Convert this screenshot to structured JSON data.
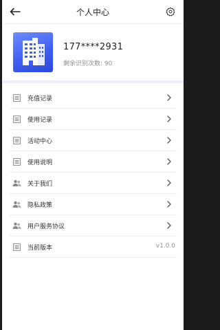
{
  "header": {
    "title": "个人中心"
  },
  "profile": {
    "phone": "177****2931",
    "remaining": "剩余识别次数: 90"
  },
  "menu": [
    {
      "label": "充值记录",
      "icon": "list-icon"
    },
    {
      "label": "使用记录",
      "icon": "list-icon"
    },
    {
      "label": "活动中心",
      "icon": "list-icon"
    },
    {
      "label": "使用说明",
      "icon": "list-icon"
    },
    {
      "label": "关于我们",
      "icon": "users-icon"
    },
    {
      "label": "隐私政策",
      "icon": "users-icon"
    },
    {
      "label": "用户服务协议",
      "icon": "users-icon"
    },
    {
      "label": "当前版本",
      "icon": "list-icon",
      "value": "v1.0.0"
    }
  ],
  "colors": {
    "accent": "#3d5cf0",
    "band": "#eef0f7"
  }
}
